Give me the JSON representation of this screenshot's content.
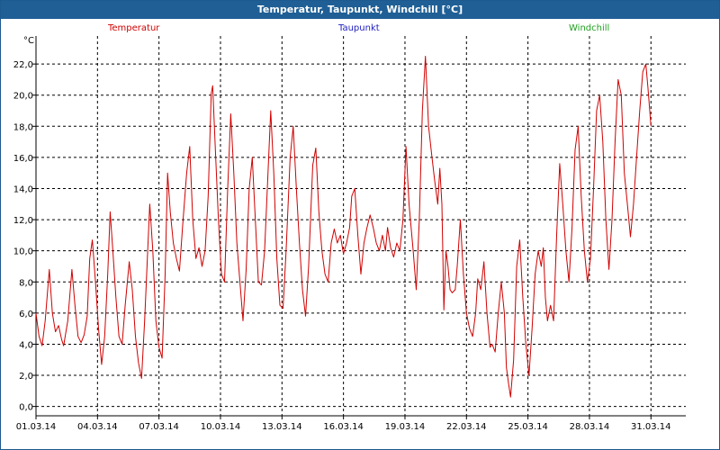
{
  "window": {
    "title": "Temperatur, Taupunkt, Windchill [°C]"
  },
  "colors": {
    "titlebar": "#1f5f95",
    "temperature": "#d00000",
    "dewpoint": "#2020c0",
    "windchill": "#20a020",
    "grid": "#000000"
  },
  "chart_data": {
    "type": "line",
    "title": "Temperatur, Taupunkt, Windchill [°C]",
    "ylabel": "°C",
    "ylim": [
      -0.6,
      23.8
    ],
    "xlim": [
      0,
      31.7
    ],
    "yticks": [
      0.0,
      2.0,
      4.0,
      6.0,
      8.0,
      10.0,
      12.0,
      14.0,
      16.0,
      18.0,
      20.0,
      22.0
    ],
    "ytick_labels": [
      "0,0",
      "2,0",
      "4,0",
      "6,0",
      "8,0",
      "10,0",
      "12,0",
      "14,0",
      "16,0",
      "18,0",
      "20,0",
      "22,0"
    ],
    "xticks": [
      0,
      3,
      6,
      9,
      12,
      15,
      18,
      21,
      24,
      27,
      30
    ],
    "xtick_labels": [
      "01.03.14",
      "04.03.14",
      "07.03.14",
      "10.03.14",
      "13.03.14",
      "16.03.14",
      "19.03.14",
      "22.03.14",
      "25.03.14",
      "28.03.14",
      "31.03.14"
    ],
    "grid": true,
    "legend": [
      "Temperatur",
      "Taupunkt",
      "Windchill"
    ],
    "series": [
      {
        "name": "Temperatur",
        "points": [
          [
            0.0,
            6.0
          ],
          [
            0.15,
            4.5
          ],
          [
            0.3,
            3.9
          ],
          [
            0.45,
            5.5
          ],
          [
            0.65,
            8.8
          ],
          [
            0.8,
            6.0
          ],
          [
            0.95,
            4.8
          ],
          [
            1.1,
            5.2
          ],
          [
            1.25,
            4.3
          ],
          [
            1.35,
            3.9
          ],
          [
            1.55,
            5.5
          ],
          [
            1.75,
            8.8
          ],
          [
            1.9,
            6.5
          ],
          [
            2.05,
            4.5
          ],
          [
            2.2,
            4.1
          ],
          [
            2.35,
            4.6
          ],
          [
            2.5,
            5.8
          ],
          [
            2.62,
            9.5
          ],
          [
            2.75,
            10.7
          ],
          [
            2.9,
            8.0
          ],
          [
            3.05,
            5.0
          ],
          [
            3.2,
            2.7
          ],
          [
            3.35,
            4.5
          ],
          [
            3.5,
            8.5
          ],
          [
            3.62,
            12.5
          ],
          [
            3.75,
            10.0
          ],
          [
            3.9,
            7.0
          ],
          [
            4.05,
            4.5
          ],
          [
            4.2,
            4.0
          ],
          [
            4.35,
            6.5
          ],
          [
            4.55,
            9.3
          ],
          [
            4.7,
            7.5
          ],
          [
            4.85,
            4.5
          ],
          [
            5.0,
            2.8
          ],
          [
            5.15,
            1.8
          ],
          [
            5.3,
            5.5
          ],
          [
            5.45,
            10.0
          ],
          [
            5.55,
            13.0
          ],
          [
            5.7,
            10.0
          ],
          [
            5.85,
            5.5
          ],
          [
            6.0,
            3.8
          ],
          [
            6.15,
            3.1
          ],
          [
            6.3,
            8.5
          ],
          [
            6.42,
            15.0
          ],
          [
            6.55,
            12.5
          ],
          [
            6.7,
            10.5
          ],
          [
            6.85,
            9.5
          ],
          [
            7.0,
            8.7
          ],
          [
            7.15,
            11.5
          ],
          [
            7.35,
            15.0
          ],
          [
            7.5,
            16.7
          ],
          [
            7.65,
            12.0
          ],
          [
            7.8,
            9.5
          ],
          [
            7.95,
            10.2
          ],
          [
            8.1,
            9.0
          ],
          [
            8.25,
            10.0
          ],
          [
            8.4,
            13.5
          ],
          [
            8.55,
            20.1
          ],
          [
            8.62,
            20.6
          ],
          [
            8.75,
            16.5
          ],
          [
            8.9,
            12.0
          ],
          [
            9.05,
            8.5
          ],
          [
            9.2,
            8.0
          ],
          [
            9.35,
            14.0
          ],
          [
            9.5,
            18.8
          ],
          [
            9.65,
            15.0
          ],
          [
            9.8,
            10.5
          ],
          [
            9.95,
            8.0
          ],
          [
            10.1,
            5.5
          ],
          [
            10.25,
            8.8
          ],
          [
            10.4,
            14.0
          ],
          [
            10.55,
            16.0
          ],
          [
            10.7,
            12.0
          ],
          [
            10.85,
            8.0
          ],
          [
            11.0,
            7.8
          ],
          [
            11.15,
            10.0
          ],
          [
            11.3,
            14.5
          ],
          [
            11.45,
            19.0
          ],
          [
            11.6,
            15.0
          ],
          [
            11.75,
            9.5
          ],
          [
            11.9,
            6.5
          ],
          [
            12.05,
            6.3
          ],
          [
            12.2,
            10.0
          ],
          [
            12.4,
            16.0
          ],
          [
            12.55,
            18.0
          ],
          [
            12.7,
            14.0
          ],
          [
            12.85,
            10.5
          ],
          [
            13.0,
            7.5
          ],
          [
            13.15,
            5.8
          ],
          [
            13.3,
            9.0
          ],
          [
            13.5,
            15.5
          ],
          [
            13.65,
            16.6
          ],
          [
            13.8,
            12.5
          ],
          [
            13.95,
            10.0
          ],
          [
            14.1,
            8.5
          ],
          [
            14.25,
            8.0
          ],
          [
            14.4,
            10.5
          ],
          [
            14.55,
            11.4
          ],
          [
            14.7,
            10.5
          ],
          [
            14.85,
            11.0
          ],
          [
            15.0,
            9.8
          ],
          [
            15.15,
            10.5
          ],
          [
            15.3,
            11.5
          ],
          [
            15.4,
            13.5
          ],
          [
            15.55,
            14.0
          ],
          [
            15.7,
            11.0
          ],
          [
            15.85,
            8.5
          ],
          [
            16.0,
            10.5
          ],
          [
            16.15,
            11.5
          ],
          [
            16.3,
            12.3
          ],
          [
            16.45,
            11.5
          ],
          [
            16.6,
            10.5
          ],
          [
            16.75,
            10.0
          ],
          [
            16.9,
            11.0
          ],
          [
            17.05,
            10.0
          ],
          [
            17.15,
            11.5
          ],
          [
            17.3,
            10.2
          ],
          [
            17.45,
            9.6
          ],
          [
            17.6,
            10.5
          ],
          [
            17.75,
            10.0
          ],
          [
            17.9,
            12.0
          ],
          [
            18.05,
            16.7
          ],
          [
            18.2,
            13.0
          ],
          [
            18.4,
            10.0
          ],
          [
            18.55,
            7.5
          ],
          [
            18.7,
            12.0
          ],
          [
            18.85,
            19.0
          ],
          [
            19.0,
            22.5
          ],
          [
            19.15,
            18.0
          ],
          [
            19.3,
            16.2
          ],
          [
            19.45,
            14.5
          ],
          [
            19.6,
            13.0
          ],
          [
            19.7,
            15.3
          ],
          [
            19.8,
            13.0
          ],
          [
            19.9,
            6.2
          ],
          [
            20.0,
            10.0
          ],
          [
            20.1,
            9.0
          ],
          [
            20.2,
            7.5
          ],
          [
            20.3,
            7.3
          ],
          [
            20.45,
            7.5
          ],
          [
            20.55,
            9.0
          ],
          [
            20.7,
            12.0
          ],
          [
            20.85,
            8.5
          ],
          [
            21.0,
            6.0
          ],
          [
            21.15,
            5.0
          ],
          [
            21.3,
            4.5
          ],
          [
            21.45,
            6.0
          ],
          [
            21.55,
            8.2
          ],
          [
            21.7,
            7.5
          ],
          [
            21.85,
            9.3
          ],
          [
            22.0,
            6.0
          ],
          [
            22.15,
            3.8
          ],
          [
            22.25,
            4.0
          ],
          [
            22.4,
            3.5
          ],
          [
            22.55,
            6.0
          ],
          [
            22.7,
            8.0
          ],
          [
            22.85,
            6.0
          ],
          [
            22.95,
            2.5
          ],
          [
            23.05,
            1.5
          ],
          [
            23.15,
            0.6
          ],
          [
            23.3,
            3.0
          ],
          [
            23.45,
            9.0
          ],
          [
            23.6,
            10.7
          ],
          [
            23.75,
            7.0
          ],
          [
            23.9,
            4.0
          ],
          [
            24.05,
            2.0
          ],
          [
            24.2,
            5.0
          ],
          [
            24.35,
            8.5
          ],
          [
            24.5,
            10.0
          ],
          [
            24.65,
            9.0
          ],
          [
            24.75,
            10.2
          ],
          [
            24.85,
            7.0
          ],
          [
            24.95,
            5.5
          ],
          [
            25.1,
            6.5
          ],
          [
            25.25,
            5.5
          ],
          [
            25.4,
            11.0
          ],
          [
            25.55,
            15.6
          ],
          [
            25.7,
            13.0
          ],
          [
            25.85,
            10.0
          ],
          [
            26.0,
            8.0
          ],
          [
            26.15,
            11.5
          ],
          [
            26.3,
            16.5
          ],
          [
            26.45,
            18.0
          ],
          [
            26.6,
            13.5
          ],
          [
            26.75,
            10.0
          ],
          [
            26.9,
            8.0
          ],
          [
            27.05,
            9.5
          ],
          [
            27.2,
            14.0
          ],
          [
            27.35,
            19.0
          ],
          [
            27.5,
            20.0
          ],
          [
            27.65,
            17.0
          ],
          [
            27.8,
            12.0
          ],
          [
            27.95,
            8.8
          ],
          [
            28.1,
            12.0
          ],
          [
            28.25,
            17.0
          ],
          [
            28.4,
            21.0
          ],
          [
            28.55,
            20.0
          ],
          [
            28.7,
            15.0
          ],
          [
            28.85,
            13.0
          ],
          [
            29.0,
            10.9
          ],
          [
            29.15,
            13.0
          ],
          [
            29.3,
            16.0
          ],
          [
            29.45,
            19.0
          ],
          [
            29.6,
            21.5
          ],
          [
            29.75,
            22.0
          ],
          [
            29.85,
            20.5
          ],
          [
            30.0,
            18.0
          ]
        ]
      },
      {
        "name": "Taupunkt",
        "points": []
      },
      {
        "name": "Windchill",
        "points": []
      }
    ]
  }
}
